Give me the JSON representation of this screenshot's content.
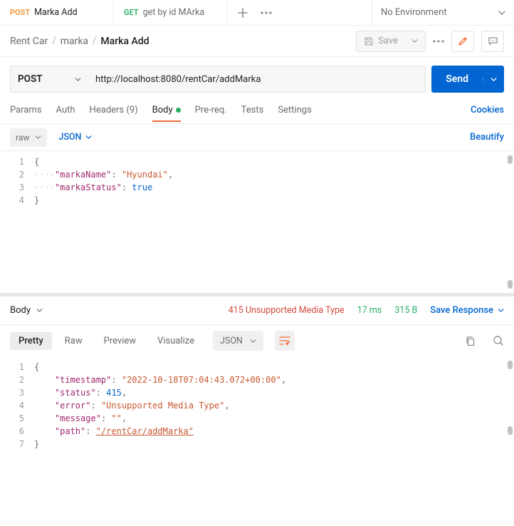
{
  "tabs": [
    {
      "method": "POST",
      "title": "Marka Add",
      "methodClass": "post"
    },
    {
      "method": "GET",
      "title": "get by id MArka",
      "methodClass": "get"
    }
  ],
  "env": {
    "label": "No Environment"
  },
  "breadcrumb": {
    "a": "Rent Car",
    "b": "marka",
    "c": "Marka Add"
  },
  "save_label": "Save",
  "method": "POST",
  "url": "http://localhost:8080/rentCar/addMarka",
  "send_label": "Send",
  "req_tabs": {
    "params": "Params",
    "auth": "Auth",
    "headers": "Headers (9)",
    "body": "Body",
    "prereq": "Pre-req.",
    "tests": "Tests",
    "settings": "Settings",
    "cookies": "Cookies"
  },
  "body_bar": {
    "raw": "raw",
    "json": "JSON",
    "beautify": "Beautify"
  },
  "request_body": {
    "lines": [
      "1",
      "2",
      "3",
      "4"
    ],
    "key1": "\"markaName\"",
    "val1": "\"Hyundai\"",
    "key2": "\"markaStatus\"",
    "val2": "true",
    "brace_open": "{",
    "brace_close": "}",
    "comma": ",",
    "colon": ": "
  },
  "response_head": {
    "body": "Body",
    "status": "415 Unsupported Media Type",
    "time": "17 ms",
    "size": "315 B",
    "save": "Save Response"
  },
  "resp_tabs": {
    "pretty": "Pretty",
    "raw": "Raw",
    "preview": "Preview",
    "visualize": "Visualize",
    "json": "JSON"
  },
  "response_body": {
    "lines": [
      "1",
      "2",
      "3",
      "4",
      "5",
      "6",
      "7"
    ],
    "k_ts": "\"timestamp\"",
    "v_ts": "\"2022-10-18T07:04:43.072+00:00\"",
    "k_st": "\"status\"",
    "v_st": "415",
    "k_er": "\"error\"",
    "v_er": "\"Unsupported Media Type\"",
    "k_mg": "\"message\"",
    "v_mg": "\"\"",
    "k_pa": "\"path\"",
    "v_pa": "\"/rentCar/addMarka\"",
    "brace_open": "{",
    "brace_close": "}",
    "comma": ",",
    "colon": ": "
  }
}
